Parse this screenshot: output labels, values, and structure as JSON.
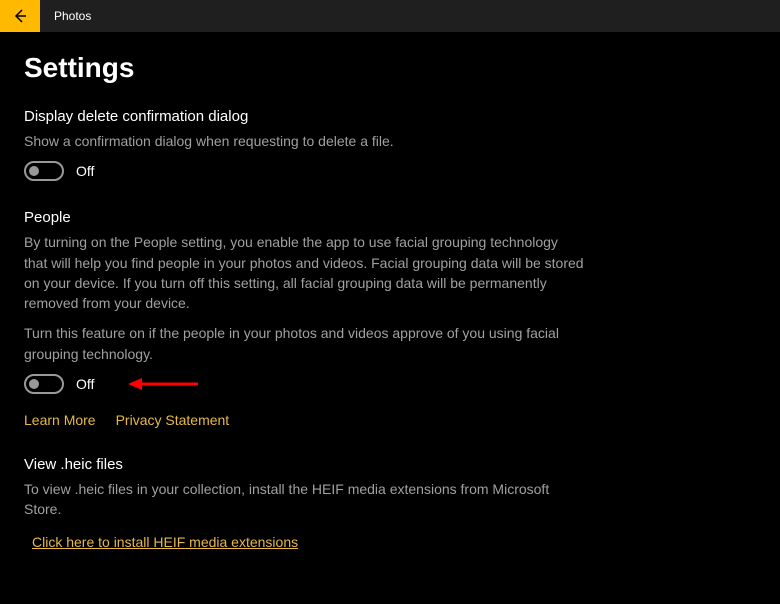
{
  "titlebar": {
    "app_name": "Photos"
  },
  "page": {
    "title": "Settings"
  },
  "sections": {
    "delete_confirm": {
      "heading": "Display delete confirmation dialog",
      "desc": "Show a confirmation dialog when requesting to delete a file.",
      "toggle_label": "Off"
    },
    "people": {
      "heading": "People",
      "desc1": "By turning on the People setting, you enable the app to use facial grouping technology that will help you find people in your photos and videos. Facial grouping data will be stored on your device. If you turn off this setting, all facial grouping data will be permanently removed from your device.",
      "desc2": "Turn this feature on if the people in your photos and videos approve of you using facial grouping technology.",
      "toggle_label": "Off",
      "learn_more": "Learn More",
      "privacy": "Privacy Statement"
    },
    "heic": {
      "heading": "View .heic files",
      "desc": "To view .heic files in your collection, install the HEIF media extensions from Microsoft Store.",
      "link": "Click here to install HEIF media extensions"
    }
  }
}
